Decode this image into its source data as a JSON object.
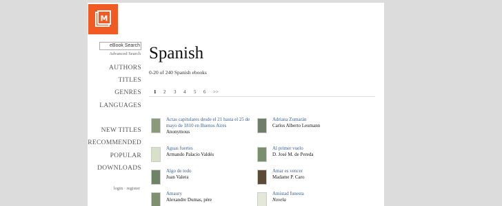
{
  "header": {
    "logo_letter": "M",
    "logo_color": "#f15a22"
  },
  "sidebar": {
    "search_label": "eBook Search",
    "advanced_search": "Advanced Search",
    "nav_primary": [
      "AUTHORS",
      "TITLES",
      "GENRES",
      "LANGUAGES"
    ],
    "nav_secondary": [
      "NEW TITLES",
      "RECOMMENDED",
      "POPULAR",
      "DOWNLOADS"
    ],
    "login_text": "login · register"
  },
  "main": {
    "title": "Spanish",
    "count": "0-20 of 240 Spanish ebooks",
    "pager": [
      "1",
      "2",
      "3",
      "4",
      "5",
      "6",
      ">>"
    ],
    "books": [
      {
        "title": "Actas capitulares desde el 21 hasta el 25 de mayo de 1810 en Buenos Aires",
        "author": "Anonymous",
        "cover": "#8a9a7a"
      },
      {
        "title": "Adriana Zumarán",
        "author": "Carlos Alberto Leumann",
        "cover": "#6e7e68"
      },
      {
        "title": "Aguas fuertes",
        "author": "Armando Palacio Valdés",
        "cover": "#d8e0c8"
      },
      {
        "title": "Al primer vuelo",
        "author": "D. José M. de Pereda",
        "cover": "#7a8f6e"
      },
      {
        "title": "Algo de todo",
        "author": "Juan Valera",
        "cover": "#6f8466"
      },
      {
        "title": "Amar es vencer",
        "author": "Madame P. Caro",
        "cover": "#5a4a36"
      },
      {
        "title": "Amaury",
        "author": "Alexandre Dumas, père",
        "cover": "#7f9070"
      },
      {
        "title": "Amistad funesta",
        "author": "Novela",
        "cover": "#e4e8d8"
      }
    ]
  }
}
